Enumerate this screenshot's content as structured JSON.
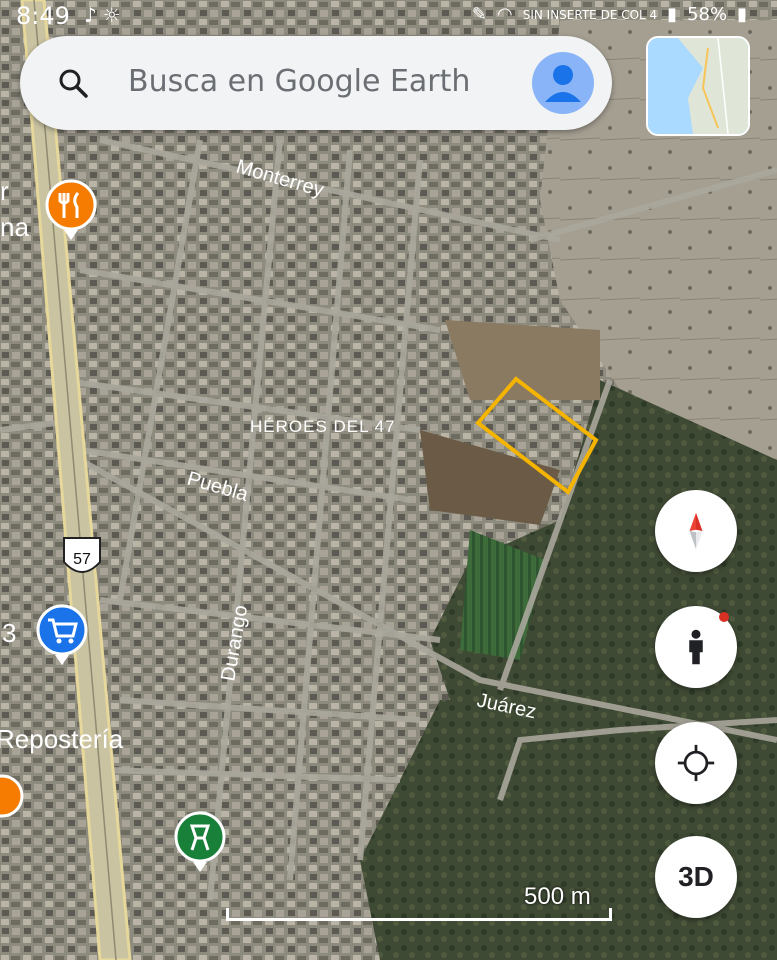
{
  "status_bar": {
    "time": "8:49",
    "carrier": "SIN INSERTE DE COL 4",
    "battery": "58%"
  },
  "search": {
    "placeholder": "Busca en Google Earth"
  },
  "map": {
    "streets": {
      "monterrey": "Monterrey",
      "puebla": "Puebla",
      "durango": "Durango",
      "juarez": "Juárez"
    },
    "neighborhood": "HÉROES DEL 47",
    "highway_shield": "57",
    "partial_labels": {
      "left_top": "r",
      "left_top2": "na",
      "left_mid": "3",
      "left_reposteria": "Repostería"
    },
    "pins": [
      {
        "type": "restaurant",
        "color": "#f57c00",
        "icon": "fork-knife-icon"
      },
      {
        "type": "shopping",
        "color": "#1a73e8",
        "icon": "cart-icon"
      },
      {
        "type": "pharmacy",
        "color": "#188038",
        "icon": "mortar-icon"
      },
      {
        "type": "orange-edge",
        "color": "#f57c00",
        "icon": "generic-pin-icon"
      }
    ],
    "highlight_color": "#f4b400"
  },
  "controls": {
    "compass_icon": "compass-icon",
    "street_view_icon": "pegman-icon",
    "location_icon": "my-location-icon",
    "three_d_label": "3D"
  },
  "scale": {
    "label": "500 m"
  }
}
